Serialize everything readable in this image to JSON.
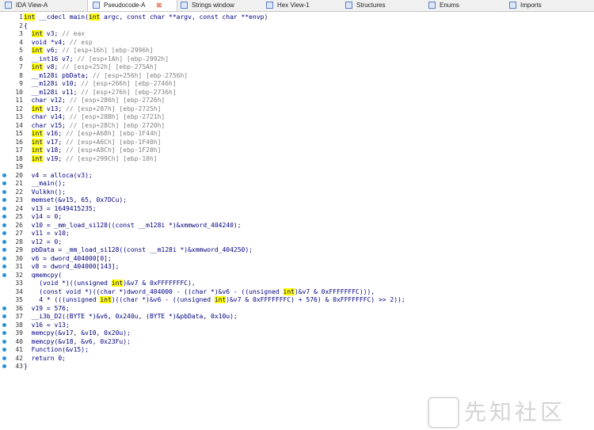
{
  "tabs": [
    {
      "label": "IDA View-A",
      "active": false
    },
    {
      "label": "Pseudocode-A",
      "active": true
    },
    {
      "label": "Strings window",
      "active": false
    },
    {
      "label": "Hex View-1",
      "active": false
    },
    {
      "label": "Structures",
      "active": false
    },
    {
      "label": "Enums",
      "active": false
    },
    {
      "label": "Imports",
      "active": false
    }
  ],
  "code_lines": [
    {
      "n": "1",
      "dot": false,
      "segs": [
        [
          "int",
          "kw"
        ],
        [
          " __cdecl main(",
          ""
        ],
        [
          "int",
          "kw"
        ],
        [
          " argc, const char **argv, const char **envp)",
          ""
        ]
      ]
    },
    {
      "n": "2",
      "dot": false,
      "segs": [
        [
          "{",
          ""
        ]
      ]
    },
    {
      "n": "3",
      "dot": false,
      "segs": [
        [
          "  ",
          ""
        ],
        [
          "int",
          "kw"
        ],
        [
          " v3; ",
          ""
        ],
        [
          "// eax",
          "cm"
        ]
      ]
    },
    {
      "n": "4",
      "dot": false,
      "segs": [
        [
          "  void *v4; ",
          ""
        ],
        [
          "// esp",
          "cm"
        ]
      ]
    },
    {
      "n": "5",
      "dot": false,
      "segs": [
        [
          "  ",
          ""
        ],
        [
          "int",
          "kw"
        ],
        [
          " v6; ",
          ""
        ],
        [
          "// [esp+16h] [ebp-2996h]",
          "cm"
        ]
      ]
    },
    {
      "n": "6",
      "dot": false,
      "segs": [
        [
          "  __int16 v7; ",
          ""
        ],
        [
          "// [esp+1Ah] [ebp-2992h]",
          "cm"
        ]
      ]
    },
    {
      "n": "7",
      "dot": false,
      "segs": [
        [
          "  ",
          ""
        ],
        [
          "int",
          "kw"
        ],
        [
          " v8; ",
          ""
        ],
        [
          "// [esp+252h] [ebp-275Ah]",
          "cm"
        ]
      ]
    },
    {
      "n": "8",
      "dot": false,
      "segs": [
        [
          "  __m128i pbData; ",
          ""
        ],
        [
          "// [esp+256h] [ebp-2756h]",
          "cm"
        ]
      ]
    },
    {
      "n": "9",
      "dot": false,
      "segs": [
        [
          "  __m128i v10; ",
          ""
        ],
        [
          "// [esp+266h] [ebp-2746h]",
          "cm"
        ]
      ]
    },
    {
      "n": "10",
      "dot": false,
      "segs": [
        [
          "  __m128i v11; ",
          ""
        ],
        [
          "// [esp+276h] [ebp-2736h]",
          "cm"
        ]
      ]
    },
    {
      "n": "11",
      "dot": false,
      "segs": [
        [
          "  char v12; ",
          ""
        ],
        [
          "// [esp+286h] [ebp-2726h]",
          "cm"
        ]
      ]
    },
    {
      "n": "12",
      "dot": false,
      "segs": [
        [
          "  ",
          ""
        ],
        [
          "int",
          "kw"
        ],
        [
          " v13; ",
          ""
        ],
        [
          "// [esp+287h] [ebp-2725h]",
          "cm"
        ]
      ]
    },
    {
      "n": "13",
      "dot": false,
      "segs": [
        [
          "  char v14; ",
          ""
        ],
        [
          "// [esp+28Bh] [ebp-2721h]",
          "cm"
        ]
      ]
    },
    {
      "n": "14",
      "dot": false,
      "segs": [
        [
          "  char v15; ",
          ""
        ],
        [
          "// [esp+28Ch] [ebp-2720h]",
          "cm"
        ]
      ]
    },
    {
      "n": "15",
      "dot": false,
      "segs": [
        [
          "  ",
          ""
        ],
        [
          "int",
          "kw"
        ],
        [
          " v16; ",
          ""
        ],
        [
          "// [esp+A68h] [ebp-1F44h]",
          "cm"
        ]
      ]
    },
    {
      "n": "16",
      "dot": false,
      "segs": [
        [
          "  ",
          ""
        ],
        [
          "int",
          "kw"
        ],
        [
          " v17; ",
          ""
        ],
        [
          "// [esp+A6Ch] [ebp-1F40h]",
          "cm"
        ]
      ]
    },
    {
      "n": "17",
      "dot": false,
      "segs": [
        [
          "  ",
          ""
        ],
        [
          "int",
          "kw"
        ],
        [
          " v18; ",
          ""
        ],
        [
          "// [esp+A8Ch] [ebp-1F20h]",
          "cm"
        ]
      ]
    },
    {
      "n": "18",
      "dot": false,
      "segs": [
        [
          "  ",
          ""
        ],
        [
          "int",
          "kw"
        ],
        [
          " v19; ",
          ""
        ],
        [
          "// [esp+299Ch] [ebp-10h]",
          "cm"
        ]
      ]
    },
    {
      "n": "19",
      "dot": false,
      "segs": [
        [
          "",
          ""
        ]
      ]
    },
    {
      "n": "20",
      "dot": true,
      "segs": [
        [
          "  v4 = alloca(v3);",
          ""
        ]
      ]
    },
    {
      "n": "21",
      "dot": true,
      "segs": [
        [
          "  __main();",
          ""
        ]
      ]
    },
    {
      "n": "22",
      "dot": true,
      "segs": [
        [
          "  Vulkkn();",
          ""
        ]
      ]
    },
    {
      "n": "23",
      "dot": true,
      "segs": [
        [
          "  memset(&v15, 65, 0x7DCu);",
          ""
        ]
      ]
    },
    {
      "n": "24",
      "dot": true,
      "segs": [
        [
          "  v13 = 1649415235;",
          ""
        ]
      ]
    },
    {
      "n": "25",
      "dot": true,
      "segs": [
        [
          "  v14 = 0;",
          ""
        ]
      ]
    },
    {
      "n": "26",
      "dot": true,
      "segs": [
        [
          "  v10 = _mm_load_si128((const __m128i *)&xmmword_404240);",
          ""
        ]
      ]
    },
    {
      "n": "27",
      "dot": true,
      "segs": [
        [
          "  v11 = v10;",
          ""
        ]
      ]
    },
    {
      "n": "28",
      "dot": true,
      "segs": [
        [
          "  v12 = 0;",
          ""
        ]
      ]
    },
    {
      "n": "29",
      "dot": true,
      "segs": [
        [
          "  pbData = _mm_load_si128((const __m128i *)&xmmword_404250);",
          ""
        ]
      ]
    },
    {
      "n": "30",
      "dot": true,
      "segs": [
        [
          "  v6 = dword_404000[0];",
          ""
        ]
      ]
    },
    {
      "n": "31",
      "dot": true,
      "segs": [
        [
          "  v8 = dword_404000[143];",
          ""
        ]
      ]
    },
    {
      "n": "32",
      "dot": true,
      "segs": [
        [
          "  qmemcpy(",
          ""
        ]
      ]
    },
    {
      "n": "33",
      "dot": false,
      "segs": [
        [
          "    (void *)((unsigned ",
          ""
        ],
        [
          "int",
          "kw"
        ],
        [
          ")&v7 & 0xFFFFFFFC),",
          ""
        ]
      ]
    },
    {
      "n": "34",
      "dot": false,
      "segs": [
        [
          "    (const void *)((char *)dword_404000 - ((char *)&v6 - ((unsigned ",
          ""
        ],
        [
          "int",
          "kw"
        ],
        [
          ")&v7 & 0xFFFFFFFC))),",
          ""
        ]
      ]
    },
    {
      "n": "35",
      "dot": false,
      "segs": [
        [
          "    4 * (((unsigned ",
          ""
        ],
        [
          "int",
          "kw"
        ],
        [
          ")((char *)&v6 - ((unsigned ",
          ""
        ],
        [
          "int",
          "kw"
        ],
        [
          ")&v7 & 0xFFFFFFFC) + 576) & 0xFFFFFFFC) >> 2));",
          ""
        ]
      ]
    },
    {
      "n": "36",
      "dot": true,
      "segs": [
        [
          "  v19 = 576;",
          ""
        ]
      ]
    },
    {
      "n": "37",
      "dot": true,
      "segs": [
        [
          "  __i3b_D2((BYTE *)&v6, 0x240u, (BYTE *)&pbData, 0x10u);",
          ""
        ]
      ]
    },
    {
      "n": "38",
      "dot": true,
      "segs": [
        [
          "  v16 = v13;",
          ""
        ]
      ]
    },
    {
      "n": "39",
      "dot": true,
      "segs": [
        [
          "  memcpy(&v17, &v10, 0x20u);",
          ""
        ]
      ]
    },
    {
      "n": "40",
      "dot": true,
      "segs": [
        [
          "  memcpy(&v18, &v6, 0x23Fu);",
          ""
        ]
      ]
    },
    {
      "n": "41",
      "dot": true,
      "segs": [
        [
          "  Function(&v15);",
          ""
        ]
      ]
    },
    {
      "n": "42",
      "dot": true,
      "segs": [
        [
          "  return 0;",
          ""
        ]
      ]
    },
    {
      "n": "43",
      "dot": true,
      "segs": [
        [
          "}",
          ""
        ]
      ]
    }
  ],
  "watermark": "先知社区",
  "colors": {
    "keyword_highlight": "#ffff00",
    "code_text": "#000080",
    "comment": "#808080",
    "breakpoint_dot": "#2b8fd8"
  }
}
